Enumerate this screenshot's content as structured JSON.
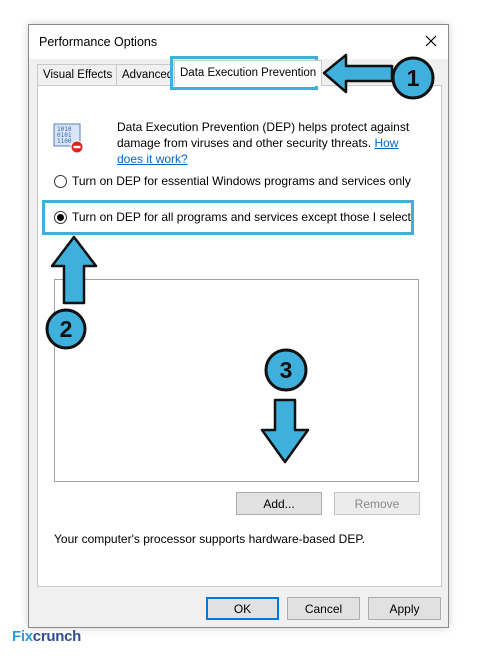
{
  "window": {
    "title": "Performance Options",
    "close_glyph": "✕"
  },
  "tabs": [
    {
      "label": "Visual Effects",
      "active": false
    },
    {
      "label": "Advanced",
      "active": false
    },
    {
      "label": "Data Execution Prevention",
      "active": true
    }
  ],
  "content": {
    "intro_text": "Data Execution Prevention (DEP) helps protect against damage from viruses and other security threats.",
    "intro_link": "How does it work?",
    "options": [
      {
        "label": "Turn on DEP for essential Windows programs and services only",
        "checked": false
      },
      {
        "label": "Turn on DEP for all programs and services except those I select:",
        "checked": true
      }
    ],
    "add_button": "Add...",
    "remove_button": "Remove",
    "support_text": "Your computer's processor supports hardware-based DEP."
  },
  "footer": {
    "ok": "OK",
    "cancel": "Cancel",
    "apply": "Apply"
  },
  "annotations": {
    "step1": "1",
    "step2": "2",
    "step3": "3",
    "color": "#3fb0dc"
  },
  "watermark": {
    "part1": "Fix",
    "part2": "crunch",
    "color1": "#2e9bd6",
    "color2": "#2f4f8f"
  }
}
